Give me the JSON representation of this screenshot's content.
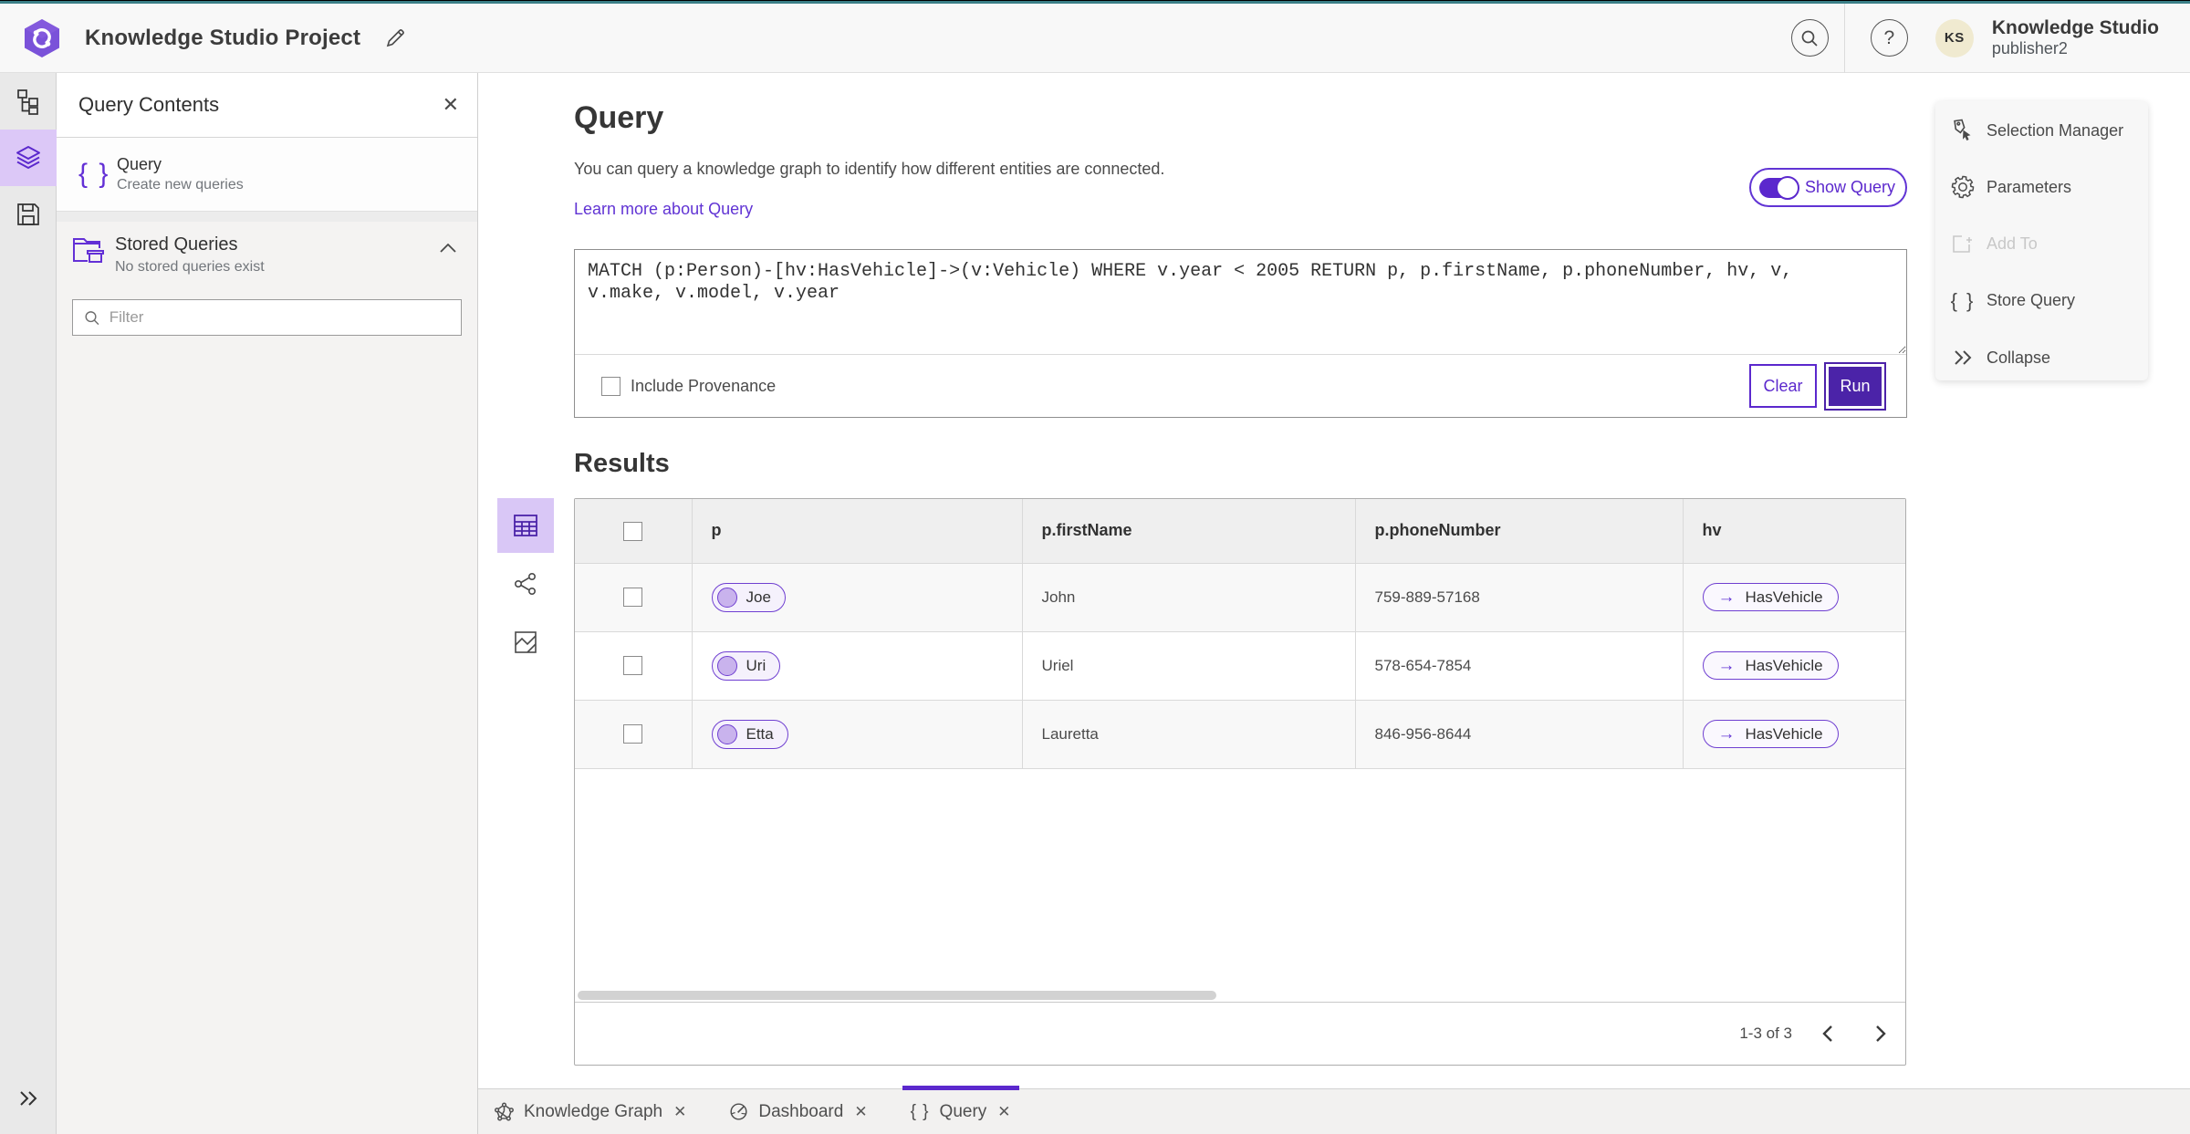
{
  "header": {
    "app_title": "Knowledge Studio Project",
    "user_name": "Knowledge Studio",
    "user_role": "publisher2",
    "avatar_initials": "KS",
    "help_glyph": "?"
  },
  "panel": {
    "title": "Query Contents",
    "query_item": {
      "icon": "{ }",
      "title": "Query",
      "subtitle": "Create new queries"
    },
    "stored": {
      "title": "Stored Queries",
      "subtitle": "No stored queries exist"
    },
    "filter_placeholder": "Filter"
  },
  "query_section": {
    "title": "Query",
    "description": "You can query a knowledge graph to identify how different entities are connected.",
    "link": "Learn more about Query",
    "toggle_label": "Show Query",
    "query_text": "MATCH (p:Person)-[hv:HasVehicle]->(v:Vehicle) WHERE v.year < 2005 RETURN p, p.firstName, p.phoneNumber, hv, v,\nv.make, v.model, v.year",
    "include_provenance": "Include Provenance",
    "clear_label": "Clear",
    "run_label": "Run"
  },
  "results": {
    "title": "Results",
    "columns": {
      "p": "p",
      "firstName": "p.firstName",
      "phoneNumber": "p.phoneNumber",
      "hv": "hv"
    },
    "rows": [
      {
        "p": "Joe",
        "firstName": "John",
        "phone": "759-889-57168",
        "hv": "HasVehicle",
        "arrow": "→"
      },
      {
        "p": "Uri",
        "firstName": "Uriel",
        "phone": "578-654-7854",
        "hv": "HasVehicle",
        "arrow": "→"
      },
      {
        "p": "Etta",
        "firstName": "Lauretta",
        "phone": "846-956-8644",
        "hv": "HasVehicle",
        "arrow": "→"
      }
    ],
    "pagination": "1-3 of 3"
  },
  "tools_panel": {
    "items": [
      {
        "label": "Selection Manager"
      },
      {
        "label": "Parameters"
      },
      {
        "label": "Add To"
      },
      {
        "label": "Store Query",
        "icon_glyph": "{ }"
      },
      {
        "label": "Collapse"
      }
    ]
  },
  "tabs": [
    {
      "label": "Knowledge Graph",
      "close": "✕"
    },
    {
      "label": "Dashboard",
      "close": "✕"
    },
    {
      "label": "Query",
      "close": "✕",
      "icon_glyph": "{ }"
    }
  ],
  "colors": {
    "accent_purple": "#5b28cd",
    "run_purple": "#4b23a8",
    "top_strip_teal": "#3a7f87",
    "rail_active": "#dcc8f7"
  }
}
